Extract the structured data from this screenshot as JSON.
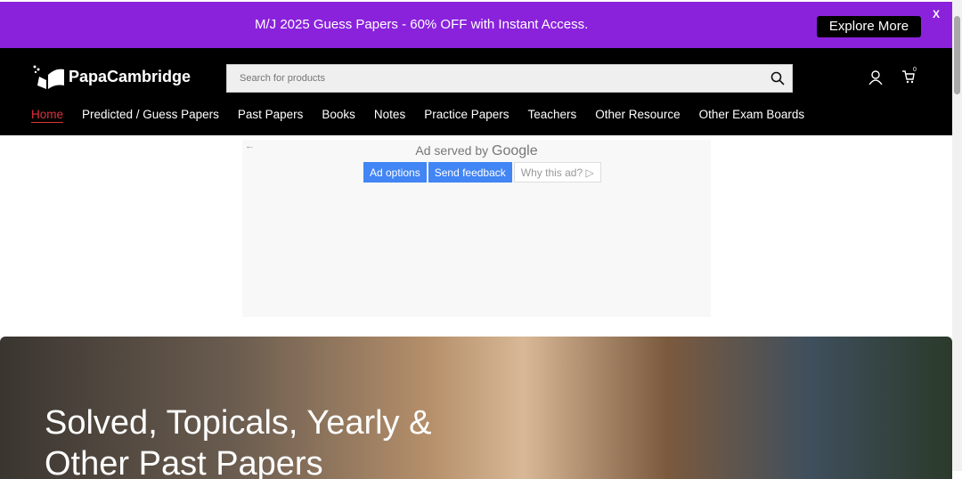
{
  "promo": {
    "text": "M/J 2025 Guess Papers - 60% OFF with Instant Access.",
    "button": "Explore More",
    "close": "X"
  },
  "header": {
    "logo": "PapaCambridge",
    "search_placeholder": "Search for products",
    "cart_count": "0"
  },
  "nav": [
    "Home",
    "Predicted / Guess Papers",
    "Past Papers",
    "Books",
    "Notes",
    "Practice Papers",
    "Teachers",
    "Other Resource",
    "Other Exam Boards"
  ],
  "ad": {
    "back": "←",
    "served_by": "Ad served by",
    "google": "Google",
    "options": "Ad options",
    "feedback": "Send feedback",
    "why": "Why this ad? ▷"
  },
  "hero": {
    "title": "Solved, Topicals, Yearly & Other Past Papers"
  },
  "colors": {
    "promo": "#8a22dc",
    "accent": "#e0323c",
    "ad_button": "#4285f4"
  }
}
